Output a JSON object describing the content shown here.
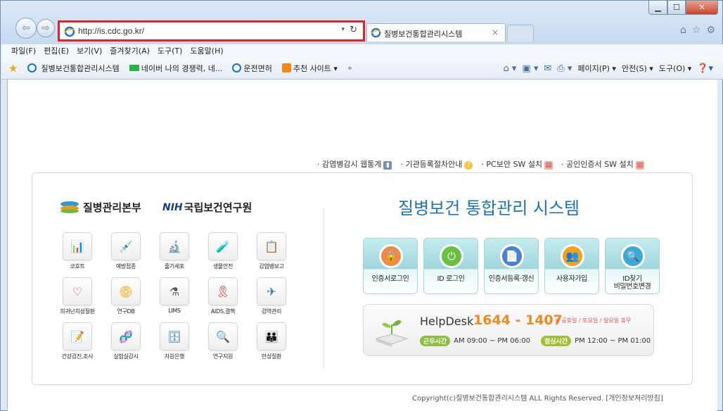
{
  "browser": {
    "url": "http://is.cdc.go.kr/",
    "tab_title": "질병보건통합관리시스템",
    "tab_close": "×",
    "menu": [
      "파일(F)",
      "편집(E)",
      "보기(V)",
      "즐겨찾기(A)",
      "도구(T)",
      "도움말(H)"
    ],
    "favorites": [
      {
        "label": "질병보건통합관리시스템",
        "icon": "ie-icon"
      },
      {
        "label": "네이버 나의 경쟁력, 네...",
        "icon": "naver-icon"
      },
      {
        "label": "운전면허",
        "icon": "ie-icon"
      },
      {
        "label": "추천 사이트 ▾",
        "icon": "suggested-sites-icon"
      }
    ],
    "commands": [
      "페이지(P) ▾",
      "안전(S) ▾",
      "도구(O) ▾"
    ]
  },
  "page": {
    "top_links": [
      {
        "label": "· 감염병감시 웹통계",
        "icon": "chart-icon"
      },
      {
        "label": "· 기관등록절차안내",
        "icon": "help-icon"
      },
      {
        "label": "· PC보안 SW 설치",
        "icon": "install-icon"
      },
      {
        "label": "· 공인인증서 SW 설치",
        "icon": "install-icon"
      }
    ],
    "logo_kcdc": "질병관리본부",
    "logo_nih_mark": "NIH",
    "logo_nih": "국립보건연구원",
    "system_title": "질병보건 통합관리 시스템",
    "apps": [
      {
        "label": "코호트",
        "glyph": "📊",
        "color": "#3b6fb5"
      },
      {
        "label": "예방접종",
        "glyph": "💉",
        "color": "#5b8c3a"
      },
      {
        "label": "줄기세포",
        "glyph": "🔬",
        "color": "#3a5a8c"
      },
      {
        "label": "생물안전",
        "glyph": "🧪",
        "color": "#e08a1c"
      },
      {
        "label": "감염병보고",
        "glyph": "📋",
        "color": "#e06a2c"
      },
      {
        "label": "희귀난치성질환",
        "glyph": "♡",
        "color": "#d94f6b"
      },
      {
        "label": "연구DB",
        "glyph": "📀",
        "color": "#333333"
      },
      {
        "label": "LIMS",
        "glyph": "⚗",
        "color": "#555555"
      },
      {
        "label": "AIDS,결핵",
        "glyph": "🎗",
        "color": "#d7262e"
      },
      {
        "label": "검역관리",
        "glyph": "✈",
        "color": "#3a77c2"
      },
      {
        "label": "건강검진,조사",
        "glyph": "📝",
        "color": "#3b8f4e"
      },
      {
        "label": "실험실감시",
        "glyph": "🧬",
        "color": "#c94a2c"
      },
      {
        "label": "자원은행",
        "glyph": "🗄",
        "color": "#2a7bbf"
      },
      {
        "label": "연구지원",
        "glyph": "🔍",
        "color": "#3a8fa0"
      },
      {
        "label": "만성질환",
        "glyph": "👪",
        "color": "#7a56a8"
      }
    ],
    "actions": [
      {
        "label": "인증서로그인",
        "glyph": "🔒",
        "color": "#f08a4a"
      },
      {
        "label": "ID 로그인",
        "glyph": "⏻",
        "color": "#6abf3f"
      },
      {
        "label": "인증서등록·갱신",
        "glyph": "📄",
        "color": "#4a7fd1"
      },
      {
        "label": "사용자가입",
        "glyph": "👥",
        "color": "#f0a21c"
      },
      {
        "label": "ID찾기\n비밀번호변경",
        "glyph": "🔍",
        "color": "#3aa8d8"
      }
    ],
    "helpdesk": {
      "label": "HelpDesk",
      "number": "1644 - 1407",
      "note": "※ 공휴일 / 토요일 / 일요일 휴무",
      "work_label": "근무시간",
      "work_hours": "AM 09:00 ~ PM 06:00",
      "lunch_label": "점심시간",
      "lunch_hours": "PM 12:00 ~ PM 01:00"
    },
    "copyright": "Copyright(c)질병보건통합관리시스템 ALL Rights Reserved. [개인정보처리방침]"
  },
  "colors": {
    "address_highlight": "#e0232b",
    "title_blue": "#1f73b7",
    "helpdesk_orange": "#f08a1c"
  }
}
